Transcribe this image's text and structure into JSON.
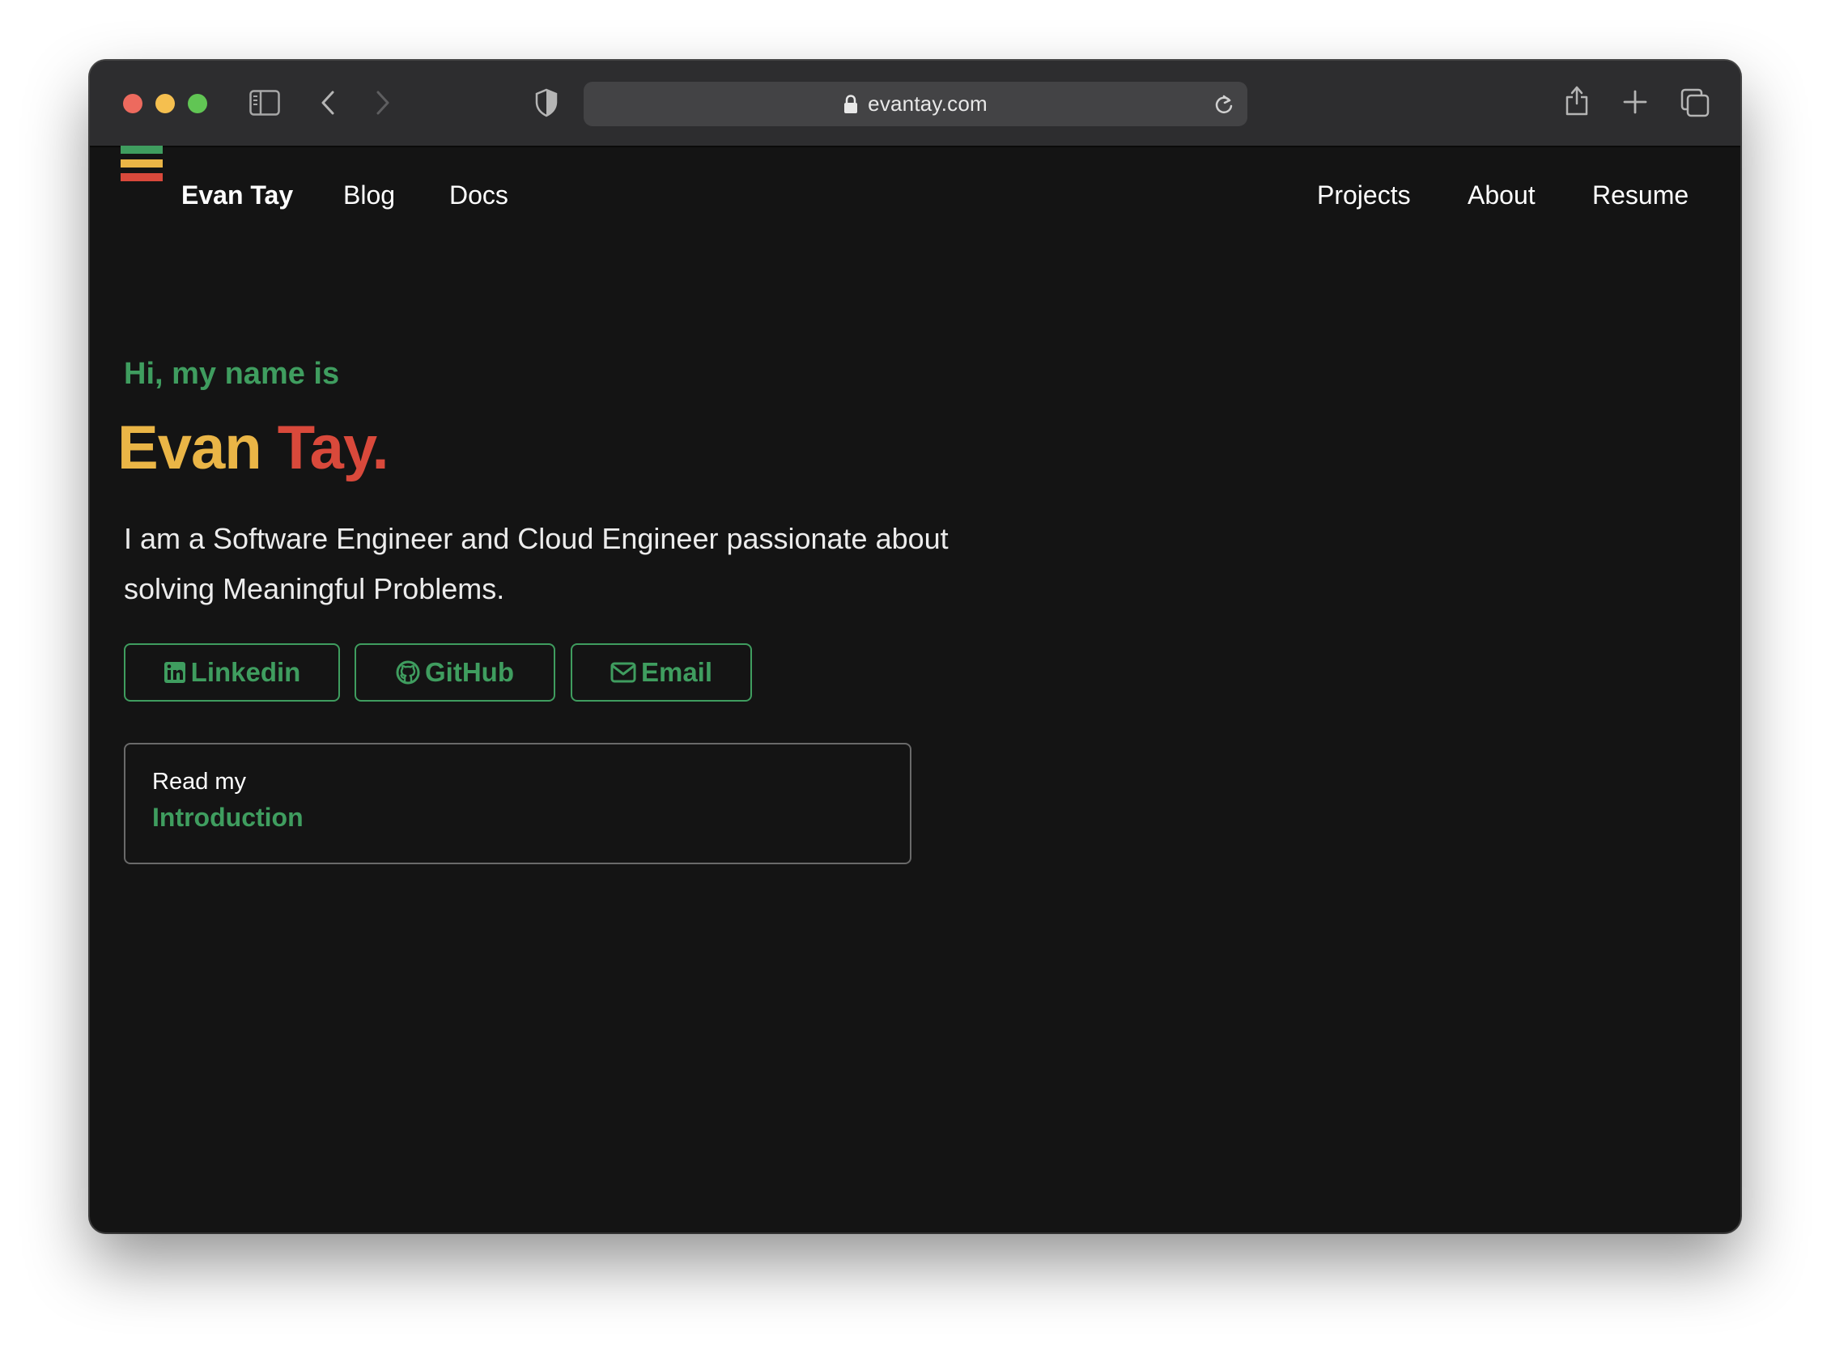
{
  "browser": {
    "url": "evantay.com"
  },
  "nav": {
    "brand": "Evan Tay",
    "left_links": [
      "Blog",
      "Docs"
    ],
    "right_links": [
      "Projects",
      "About",
      "Resume"
    ]
  },
  "hero": {
    "greeting": "Hi, my name is",
    "first_name": "Evan",
    "last_name": "Tay.",
    "tagline": "I am a Software Engineer and Cloud Engineer passionate about solving Meaningful Problems."
  },
  "buttons": {
    "linkedin": "Linkedin",
    "github": "GitHub",
    "email": "Email"
  },
  "intro_card": {
    "pre": "Read my",
    "title": "Introduction"
  },
  "colors": {
    "accent_green": "#3f9d5f",
    "accent_yellow": "#eab546",
    "accent_red": "#d9493b",
    "background": "#141414"
  }
}
